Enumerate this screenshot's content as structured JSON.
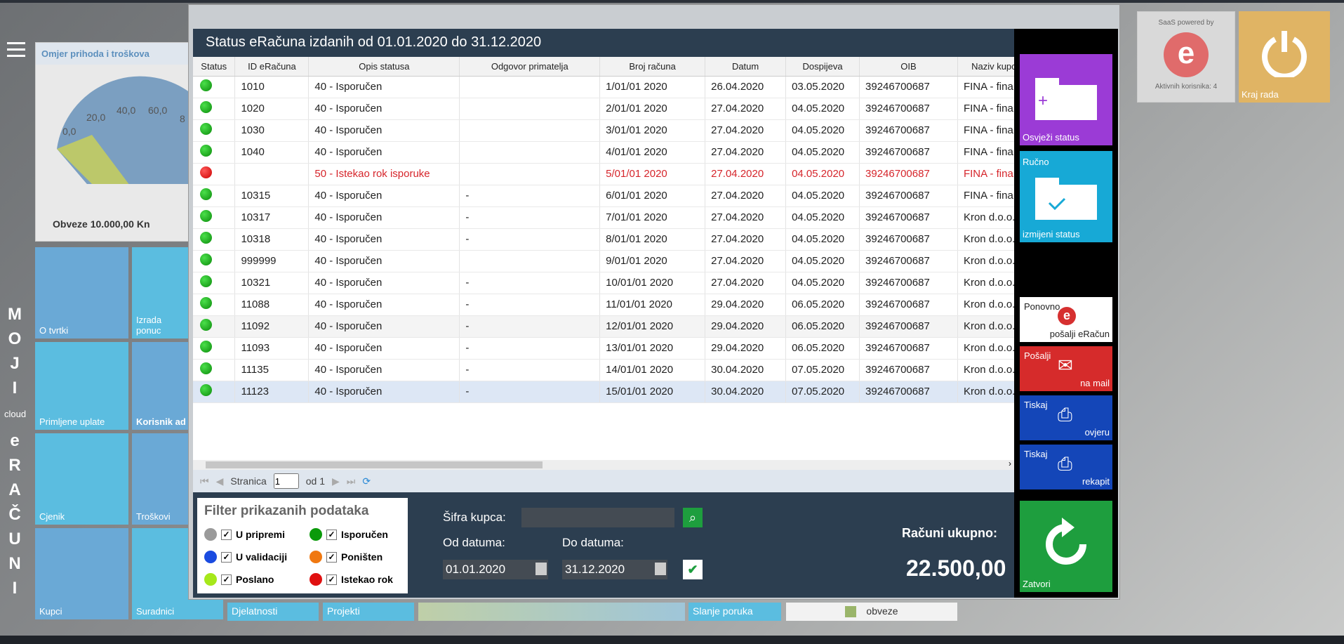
{
  "bg": {
    "gauge_title": "Omjer prihoda i troškova",
    "gauge_ticks": [
      "0,0",
      "20,0",
      "40,0",
      "60,0",
      "8"
    ],
    "gauge_footer": "Obveze 10.000,00 Kn",
    "vertical": [
      "M",
      "O",
      "J",
      "I"
    ],
    "vertical_cloud": "cloud",
    "vertical2": [
      "e",
      "R",
      "A",
      "Č",
      "U",
      "N",
      "I"
    ],
    "tiles": [
      "O tvrtki",
      "Izrada ponuc",
      "Primljene uplate",
      "Korisnik ad",
      "Cjenik",
      "Troškovi",
      "Kupci",
      "Suradnici"
    ],
    "bottom_tiles": [
      "Djelatnosti",
      "Projekti",
      "Slanje poruka",
      "obveze"
    ],
    "saas_top": "SaaS powered by",
    "saas_bottom": "Aktivnih korisnika: 4",
    "kraj": "Kraj rada"
  },
  "dialog": {
    "title": "Status eRačuna izdanih od 01.01.2020 do 31.12.2020",
    "columns": [
      "Status",
      "ID eRačuna",
      "Opis statusa",
      "Odgovor primatelja",
      "Broj računa",
      "Datum",
      "Dospijeva",
      "OIB",
      "Naziv kupca"
    ],
    "rows": [
      [
        "g",
        "1010",
        "40 - Isporučen",
        "",
        "1/01/01 2020",
        "26.04.2020",
        "03.05.2020",
        "39246700687",
        "FINA - fina"
      ],
      [
        "g",
        "1020",
        "40 - Isporučen",
        "",
        "2/01/01 2020",
        "27.04.2020",
        "04.05.2020",
        "39246700687",
        "FINA - fina"
      ],
      [
        "g",
        "1030",
        "40 - Isporučen",
        "",
        "3/01/01 2020",
        "27.04.2020",
        "04.05.2020",
        "39246700687",
        "FINA - fina"
      ],
      [
        "g",
        "1040",
        "40 - Isporučen",
        "",
        "4/01/01 2020",
        "27.04.2020",
        "04.05.2020",
        "39246700687",
        "FINA - fina"
      ],
      [
        "r",
        "",
        "50 - Istekao rok isporuke",
        "",
        "5/01/01 2020",
        "27.04.2020",
        "04.05.2020",
        "39246700687",
        "FINA - fina"
      ],
      [
        "g",
        "10315",
        "40 - Isporučen",
        "-",
        "6/01/01 2020",
        "27.04.2020",
        "04.05.2020",
        "39246700687",
        "FINA - fina"
      ],
      [
        "g",
        "10317",
        "40 - Isporučen",
        "-",
        "7/01/01 2020",
        "27.04.2020",
        "04.05.2020",
        "39246700687",
        "Kron d.o.o."
      ],
      [
        "g",
        "10318",
        "40 - Isporučen",
        "-",
        "8/01/01 2020",
        "27.04.2020",
        "04.05.2020",
        "39246700687",
        "Kron d.o.o."
      ],
      [
        "g",
        "999999",
        "40 - Isporučen",
        "",
        "9/01/01 2020",
        "27.04.2020",
        "04.05.2020",
        "39246700687",
        "Kron d.o.o."
      ],
      [
        "g",
        "10321",
        "40 - Isporučen",
        "-",
        "10/01/01 2020",
        "27.04.2020",
        "04.05.2020",
        "39246700687",
        "Kron d.o.o."
      ],
      [
        "g",
        "11088",
        "40 - Isporučen",
        "-",
        "11/01/01 2020",
        "29.04.2020",
        "06.05.2020",
        "39246700687",
        "Kron d.o.o."
      ],
      [
        "g",
        "11092",
        "40 - Isporučen",
        "-",
        "12/01/01 2020",
        "29.04.2020",
        "06.05.2020",
        "39246700687",
        "Kron d.o.o."
      ],
      [
        "g",
        "11093",
        "40 - Isporučen",
        "-",
        "13/01/01 2020",
        "29.04.2020",
        "06.05.2020",
        "39246700687",
        "Kron d.o.o."
      ],
      [
        "g",
        "11135",
        "40 - Isporučen",
        "-",
        "14/01/01 2020",
        "30.04.2020",
        "07.05.2020",
        "39246700687",
        "Kron d.o.o."
      ],
      [
        "g",
        "11123",
        "40 - Isporučen",
        "-",
        "15/01/01 2020",
        "30.04.2020",
        "07.05.2020",
        "39246700687",
        "Kron d.o.o."
      ]
    ],
    "pager": {
      "label": "Stranica",
      "page": "1",
      "of": "od 1"
    },
    "filter": {
      "title": "Filter prikazanih podataka",
      "items": [
        {
          "label": "U pripremi",
          "color": "#9a9a9a"
        },
        {
          "label": "Isporučen",
          "color": "#0a9a0a"
        },
        {
          "label": "U validaciji",
          "color": "#1a4be0"
        },
        {
          "label": "Poništen",
          "color": "#f07810"
        },
        {
          "label": "Poslano",
          "color": "#a6e81a"
        },
        {
          "label": "Istekao rok",
          "color": "#e01010"
        }
      ]
    },
    "sifra_label": "Šifra kupca:",
    "od_label": "Od datuma:",
    "do_label": "Do datuma:",
    "od_value": "01.01.2020",
    "do_value": "31.12.2020",
    "total_label": "Računi ukupno:",
    "total_value": "22.500,00",
    "side": {
      "osvjezi": "Osvježi status",
      "rucno_top": "Ručno",
      "rucno_bottom": "izmijeni status",
      "ponovno_top": "Ponovno",
      "ponovno_bottom": "pošalji eRačun",
      "posalji_top": "Pošalji",
      "posalji_bottom": "na mail",
      "tiskaj1_top": "Tiskaj",
      "tiskaj1_bottom": "ovjeru",
      "tiskaj2_top": "Tiskaj",
      "tiskaj2_bottom": "rekapit",
      "zatvori": "Zatvori"
    }
  }
}
